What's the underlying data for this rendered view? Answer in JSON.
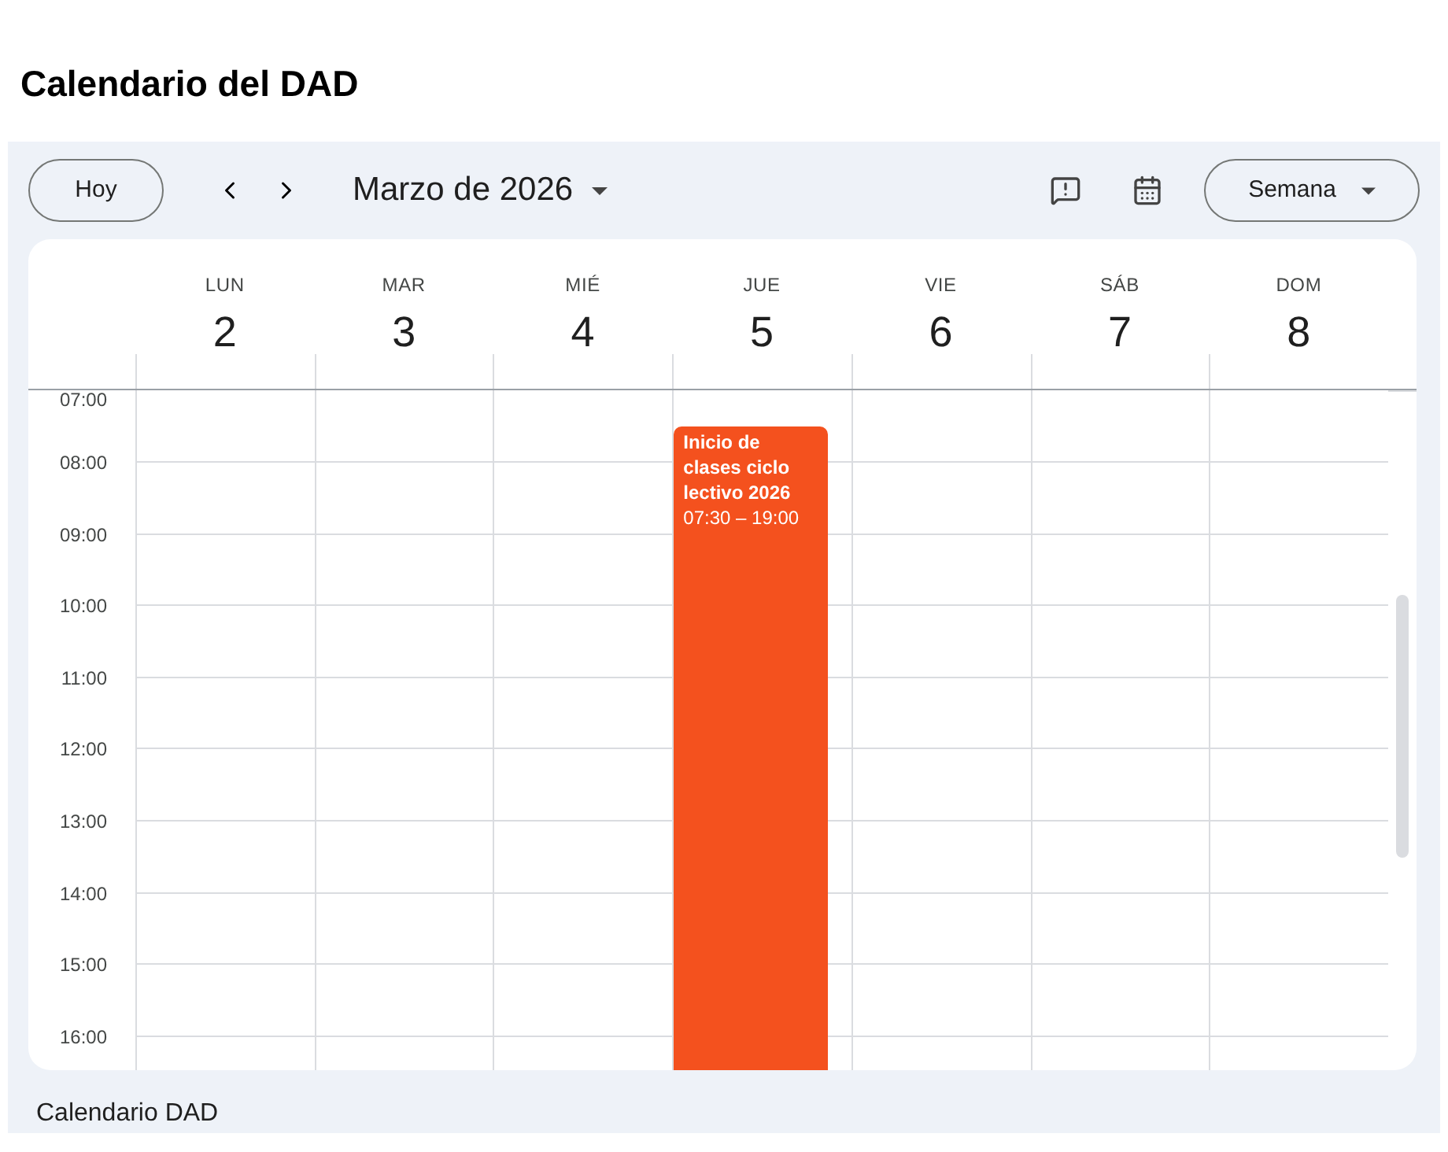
{
  "page_title": "Calendario del DAD",
  "toolbar": {
    "today": "Hoy",
    "month": "Marzo de 2026",
    "view": "Semana"
  },
  "days": [
    {
      "weekday": "LUN",
      "date": "2"
    },
    {
      "weekday": "MAR",
      "date": "3"
    },
    {
      "weekday": "MIÉ",
      "date": "4"
    },
    {
      "weekday": "JUE",
      "date": "5",
      "events": [
        {
          "title": "Inicio de clases ciclo lectivo 2026",
          "time": "07:30 – 19:00",
          "color": "#f4511e"
        }
      ]
    },
    {
      "weekday": "VIE",
      "date": "6"
    },
    {
      "weekday": "SÁB",
      "date": "7"
    },
    {
      "weekday": "DOM",
      "date": "8"
    }
  ],
  "hours": [
    "07:00",
    "08:00",
    "09:00",
    "10:00",
    "11:00",
    "12:00",
    "13:00",
    "14:00",
    "15:00",
    "16:00"
  ],
  "footer": "Calendario DAD"
}
